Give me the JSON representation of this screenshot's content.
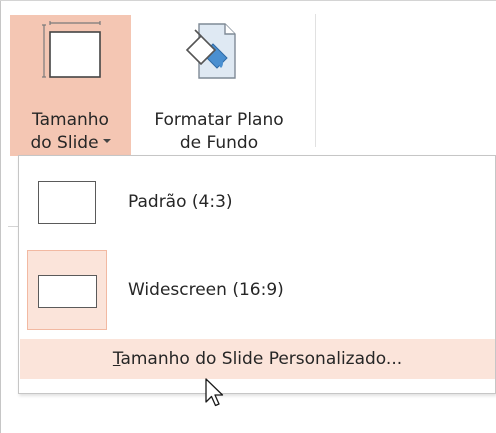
{
  "ribbon": {
    "slide_size": {
      "icon": "slide-size-icon",
      "label_line1": "Tamanho",
      "label_line2": "do Slide",
      "has_dropdown": true,
      "state": "pressed"
    },
    "format_background": {
      "icon": "format-background-icon",
      "label_line1": "Formatar Plano",
      "label_line2": "de Fundo"
    }
  },
  "dropdown": {
    "items": [
      {
        "label": "Padrão (4:3)",
        "icon": "standard-slide-thumbnail-icon",
        "selected": false
      },
      {
        "label": "Widescreen (16:9)",
        "icon": "widescreen-slide-thumbnail-icon",
        "selected": true
      }
    ],
    "custom": {
      "mnemonic": "T",
      "label_rest": "amanho do Slide Personalizado..."
    }
  },
  "colors": {
    "pressed_bg": "#f4c6b3",
    "hover_bg": "#fbe4da",
    "selected_border": "#f2b9a2"
  }
}
